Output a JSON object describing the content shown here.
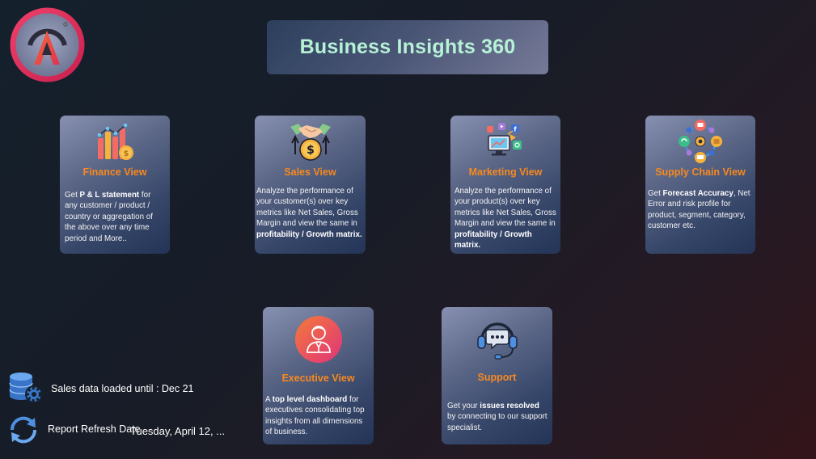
{
  "header": {
    "title": "Business Insights 360"
  },
  "cards": {
    "finance": {
      "title": "Finance View",
      "icon": "bar-chart-coins-icon",
      "desc_1": "Get ",
      "desc_bold_1": "P & L statement",
      "desc_2": " for any customer / product / country or aggregation of the above over any time period and More.."
    },
    "sales": {
      "title": "Sales View",
      "icon": "handshake-money-icon",
      "desc_1": "Analyze the performance of your customer(s) over key metrics like Net Sales, Gross Margin and view the same in ",
      "desc_bold_1": "profitability / Growth matrix."
    },
    "marketing": {
      "title": "Marketing View",
      "icon": "social-media-icon",
      "desc_1": "Analyze the performance of your product(s) over key metrics like Net Sales, Gross Margin and view the same in ",
      "desc_bold_1": "profitability / Growth matrix."
    },
    "supply_chain": {
      "title": "Supply Chain View",
      "icon": "supply-chain-cycle-icon",
      "desc_1": "Get ",
      "desc_bold_1": "Forecast Accuracy",
      "desc_2": ", Net Error and risk profile for product, segment, category, customer etc."
    },
    "executive": {
      "title": "Executive View",
      "icon": "executive-avatar-icon",
      "desc_1": "A ",
      "desc_bold_1": "top level dashboard",
      "desc_2": " for executives consolidating top insights from all dimensions of business."
    },
    "support": {
      "title": "Support",
      "icon": "headset-chat-icon",
      "desc_1": "Get your ",
      "desc_bold_1": "issues resolved",
      "desc_2": " by connecting to our support specialist."
    }
  },
  "status": {
    "sales_loaded_label": "Sales data loaded until : Dec 21",
    "refresh_label": "Report Refresh Date",
    "refresh_value": "Tuesday, April 12, ..."
  },
  "colors": {
    "title_text": "#b6f2d6",
    "card_title": "#f7891f",
    "logo_ring": "#e8335c"
  }
}
